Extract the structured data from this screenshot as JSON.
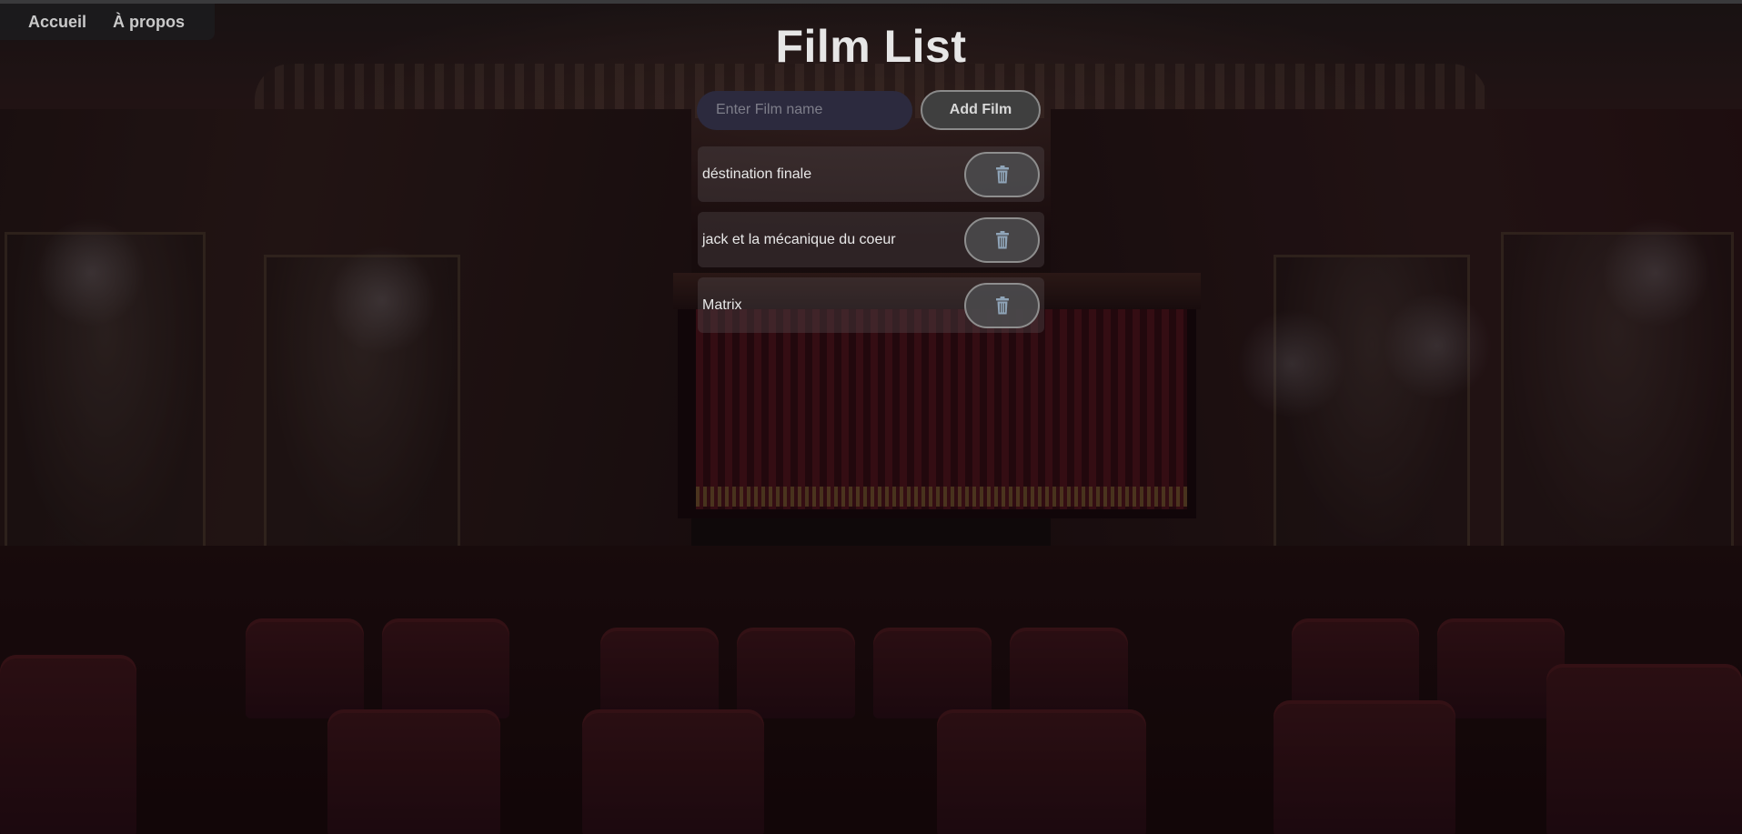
{
  "nav": {
    "links": [
      {
        "label": "Accueil"
      },
      {
        "label": "À propos"
      }
    ]
  },
  "page": {
    "title": "Film List"
  },
  "form": {
    "input_placeholder": "Enter Film name",
    "input_value": "",
    "add_button_label": "Add Film"
  },
  "films": [
    {
      "name": "déstination finale",
      "delete_icon": "trash-icon"
    },
    {
      "name": "jack et la mécanique du coeur",
      "delete_icon": "trash-icon"
    },
    {
      "name": "Matrix",
      "delete_icon": "trash-icon"
    }
  ],
  "colors": {
    "title": "#e6e6e6",
    "input_bg": "#2c2a3e",
    "button_bg": "#3f3f3f",
    "trash_icon": "#8fa4b8"
  }
}
